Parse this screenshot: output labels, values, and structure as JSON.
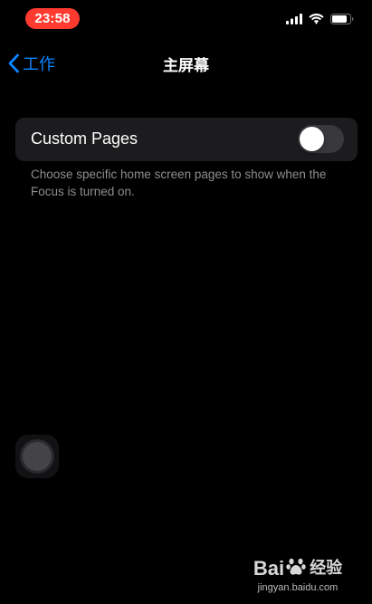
{
  "status_bar": {
    "time": "23:58",
    "icons": [
      "cellular-signal-icon",
      "wifi-icon",
      "battery-icon"
    ],
    "time_pill_color": "#ff3b30"
  },
  "nav": {
    "back_label": "工作",
    "title": "主屏幕",
    "accent_color": "#0a84ff"
  },
  "settings": {
    "custom_pages": {
      "label": "Custom Pages",
      "toggle_on": false
    },
    "footer": "Choose specific home screen pages to show when the Focus is turned on."
  },
  "watermark": {
    "logo_text_left": "Bai",
    "logo_text_right": "经验",
    "url": "jingyan.baidu.com"
  }
}
